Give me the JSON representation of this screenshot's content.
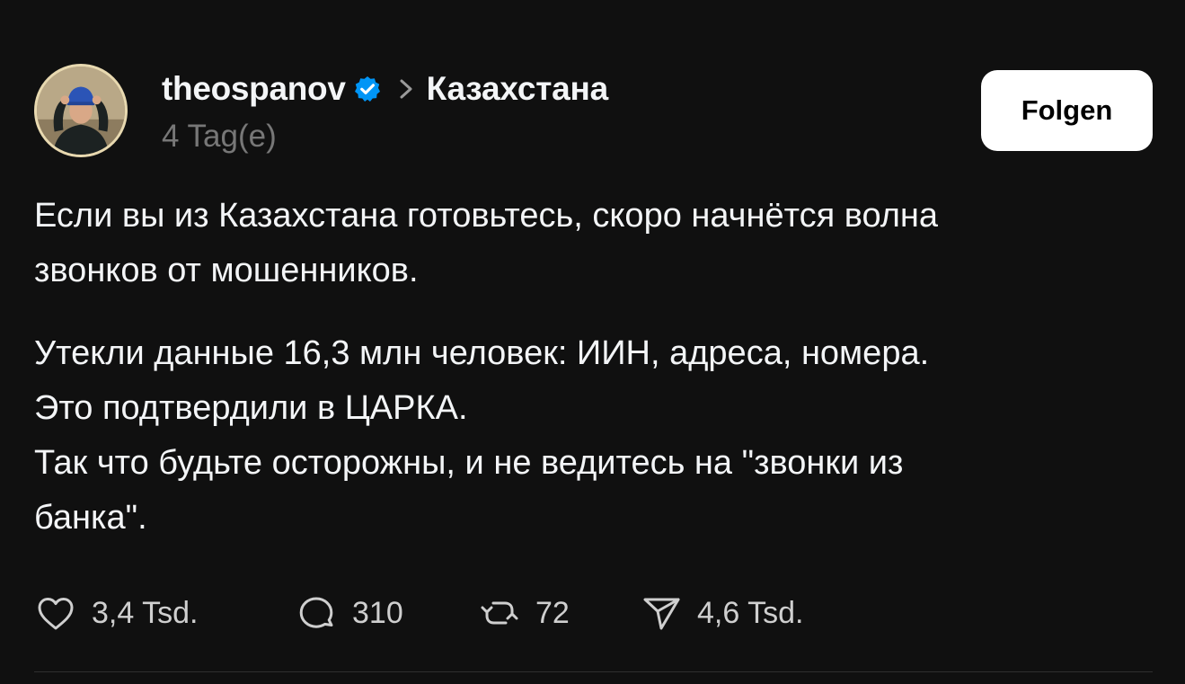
{
  "post": {
    "author": {
      "username": "theospanov",
      "verified": true,
      "topic": "Казахстана",
      "time": "4 Tag(e)"
    },
    "follow_label": "Folgen",
    "paragraphs": [
      {
        "lines": [
          "Если вы из Казахстана готовьтесь, скоро начнётся волна",
          "звонков от мошенников."
        ]
      },
      {
        "lines": [
          "Утекли данные 16,3 млн человек: ИИН, адреса, номера.",
          "Это подтвердили в ЦАРКА.",
          "Так что будьте осторожны, и не ведитесь на \"звонки из",
          "банка\"."
        ]
      }
    ],
    "actions": {
      "likes": "3,4 Tsd.",
      "replies": "310",
      "reposts": "72",
      "shares": "4,6 Tsd."
    },
    "icons": {
      "like": "heart-icon",
      "reply": "comment-bubble-icon",
      "repost": "repost-icon",
      "share": "send-icon",
      "verified": "verified-badge-icon",
      "separator": "chevron-right-icon"
    },
    "colors": {
      "background": "#101010",
      "text": "#f3f5f7",
      "muted": "#777777",
      "verified": "#0095f6",
      "button_bg": "#ffffff",
      "button_text": "#000000"
    }
  }
}
